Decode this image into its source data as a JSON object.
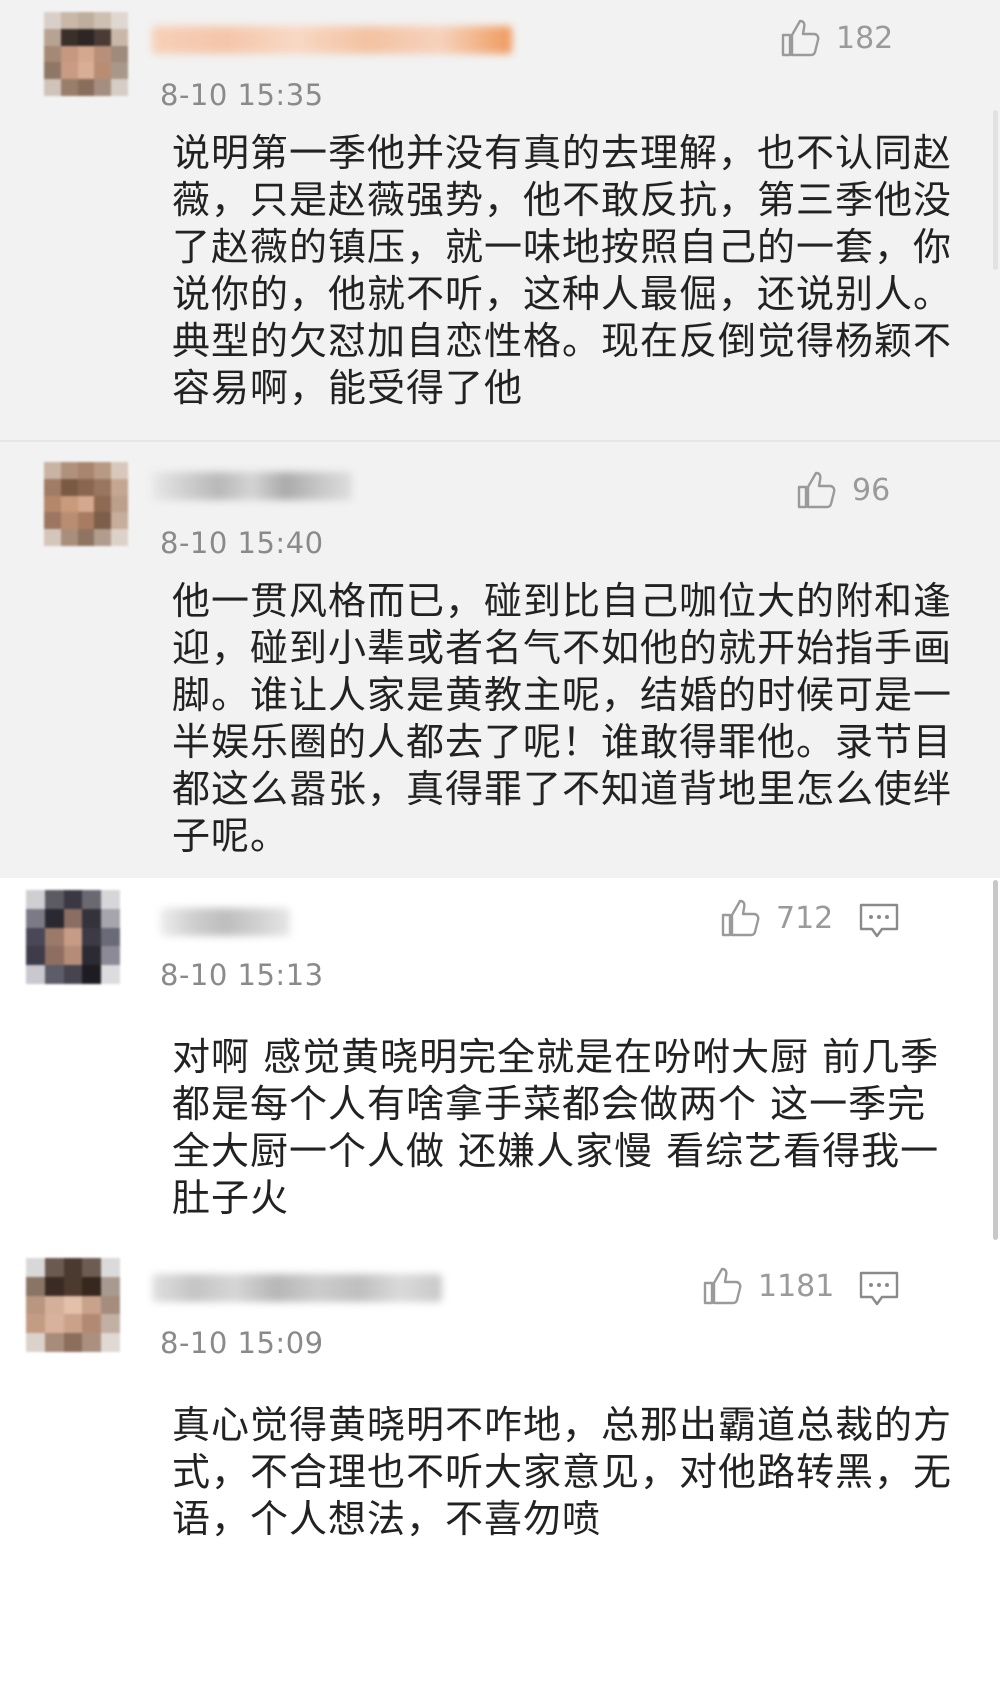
{
  "comments": [
    {
      "time": "8-10 15:35",
      "likes": "182",
      "text": "说明第一季他并没有真的去理解，也不认同赵薇，只是赵薇强势，他不敢反抗，第三季他没了赵薇的镇压，就一味地按照自己的一套，你说你的，他就不听，这种人最倔，还说别人。典型的欠怼加自恋性格。现在反倒觉得杨颖不容易啊，能受得了他"
    },
    {
      "time": "8-10 15:40",
      "likes": "96",
      "text": "他一贯风格而已，碰到比自己咖位大的附和逢迎，碰到小辈或者名气不如他的就开始指手画脚。谁让人家是黄教主呢，结婚的时候可是一半娱乐圈的人都去了呢！谁敢得罪他。录节目都这么嚣张，真得罪了不知道背地里怎么使绊子呢。"
    },
    {
      "time": "8-10 15:13",
      "likes": "712",
      "text": "对啊 感觉黄晓明完全就是在吩咐大厨 前几季都是每个人有啥拿手菜都会做两个 这一季完全大厨一个人做 还嫌人家慢 看综艺看得我一肚子火"
    },
    {
      "time": "8-10 15:09",
      "likes": "1181",
      "text": "真心觉得黄晓明不咋地，总那出霸道总裁的方式，不合理也不听大家意见，对他路转黑，无语，个人想法，不喜勿喷"
    }
  ],
  "icons": {
    "like": "thumbs-up-icon",
    "reply": "comment-bubble-icon"
  }
}
